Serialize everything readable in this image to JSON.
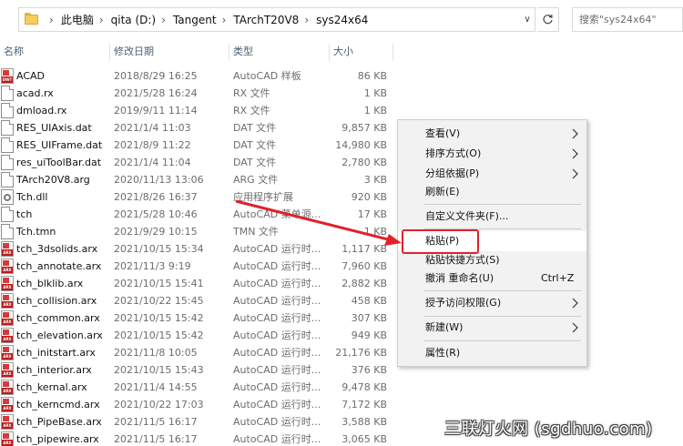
{
  "address_bar": {
    "crumbs": [
      "此电脑",
      "qita (D:)",
      "Tangent",
      "TArchT20V8",
      "sys24x64"
    ],
    "search_placeholder": "搜索\"sys24x64\""
  },
  "columns": {
    "name": "名称",
    "date": "修改日期",
    "type": "类型",
    "size": "大小"
  },
  "files": [
    {
      "name": "ACAD",
      "date": "2018/8/29 16:25",
      "type": "AutoCAD 样板",
      "size": "86 KB",
      "icon": "dwt-file-icon"
    },
    {
      "name": "acad.rx",
      "date": "2021/5/28 16:24",
      "type": "RX 文件",
      "size": "1 KB",
      "icon": "file-icon"
    },
    {
      "name": "dmload.rx",
      "date": "2019/9/11 11:14",
      "type": "RX 文件",
      "size": "1 KB",
      "icon": "file-icon"
    },
    {
      "name": "RES_UIAxis.dat",
      "date": "2021/1/4 11:03",
      "type": "DAT 文件",
      "size": "9,857 KB",
      "icon": "file-icon"
    },
    {
      "name": "RES_UIFrame.dat",
      "date": "2021/8/9 11:22",
      "type": "DAT 文件",
      "size": "14,980 KB",
      "icon": "file-icon"
    },
    {
      "name": "res_uiToolBar.dat",
      "date": "2021/1/4 11:04",
      "type": "DAT 文件",
      "size": "2,780 KB",
      "icon": "file-icon"
    },
    {
      "name": "TArch20V8.arg",
      "date": "2020/11/13 13:06",
      "type": "ARG 文件",
      "size": "3 KB",
      "icon": "file-icon"
    },
    {
      "name": "Tch.dll",
      "date": "2021/8/26 16:37",
      "type": "应用程序扩展",
      "size": "920 KB",
      "icon": "dll-gear-icon"
    },
    {
      "name": "tch",
      "date": "2021/5/28 10:46",
      "type": "AutoCAD 菜单源...",
      "size": "17 KB",
      "icon": "file-icon"
    },
    {
      "name": "Tch.tmn",
      "date": "2021/9/29 10:15",
      "type": "TMN 文件",
      "size": "1 KB",
      "icon": "file-icon"
    },
    {
      "name": "tch_3dsolids.arx",
      "date": "2021/10/15 15:34",
      "type": "AutoCAD 运行时...",
      "size": "1,117 KB",
      "icon": "arx-file-icon"
    },
    {
      "name": "tch_annotate.arx",
      "date": "2021/11/3 9:19",
      "type": "AutoCAD 运行时...",
      "size": "7,960 KB",
      "icon": "arx-file-icon"
    },
    {
      "name": "tch_blklib.arx",
      "date": "2021/10/15 15:41",
      "type": "AutoCAD 运行时...",
      "size": "2,882 KB",
      "icon": "arx-file-icon"
    },
    {
      "name": "tch_collision.arx",
      "date": "2021/10/22 15:45",
      "type": "AutoCAD 运行时...",
      "size": "458 KB",
      "icon": "arx-file-icon"
    },
    {
      "name": "tch_common.arx",
      "date": "2021/10/15 15:42",
      "type": "AutoCAD 运行时...",
      "size": "307 KB",
      "icon": "arx-file-icon"
    },
    {
      "name": "tch_elevation.arx",
      "date": "2021/10/15 15:42",
      "type": "AutoCAD 运行时...",
      "size": "949 KB",
      "icon": "arx-file-icon"
    },
    {
      "name": "tch_initstart.arx",
      "date": "2021/11/8 10:05",
      "type": "AutoCAD 运行时...",
      "size": "21,176 KB",
      "icon": "arx-file-icon"
    },
    {
      "name": "tch_interior.arx",
      "date": "2021/10/15 15:43",
      "type": "AutoCAD 运行时...",
      "size": "376 KB",
      "icon": "arx-file-icon"
    },
    {
      "name": "tch_kernal.arx",
      "date": "2021/11/4 14:55",
      "type": "AutoCAD 运行时...",
      "size": "9,478 KB",
      "icon": "arx-file-icon"
    },
    {
      "name": "tch_kerncmd.arx",
      "date": "2021/10/22 17:03",
      "type": "AutoCAD 运行时...",
      "size": "7,172 KB",
      "icon": "arx-file-icon"
    },
    {
      "name": "tch_PipeBase.arx",
      "date": "2021/11/5 16:17",
      "type": "AutoCAD 运行时...",
      "size": "3,588 KB",
      "icon": "arx-file-icon"
    },
    {
      "name": "tch_pipewire.arx",
      "date": "2021/11/5 16:17",
      "type": "AutoCAD 运行时...",
      "size": "3,065 KB",
      "icon": "arx-file-icon"
    }
  ],
  "context_menu": {
    "items": [
      {
        "label": "查看(V)",
        "submenu": true
      },
      {
        "label": "排序方式(O)",
        "submenu": true
      },
      {
        "label": "分组依据(P)",
        "submenu": true
      },
      {
        "label": "刷新(E)",
        "submenu": false
      },
      {
        "label": "自定义文件夹(F)...",
        "submenu": false
      },
      {
        "label": "粘贴(P)",
        "submenu": false,
        "highlighted": true
      },
      {
        "label": "粘贴快捷方式(S)",
        "submenu": false
      },
      {
        "label": "撤消 重命名(U)",
        "submenu": false,
        "shortcut": "Ctrl+Z"
      },
      {
        "label": "授予访问权限(G)",
        "submenu": true
      },
      {
        "label": "新建(W)",
        "submenu": true
      },
      {
        "label": "属性(R)",
        "submenu": false
      }
    ]
  },
  "watermark": "三联灯火网 (sgdhuo.com)",
  "colors": {
    "annotation_red": "#e0222c",
    "arx_red": "#b81c1c",
    "header_text": "#4c607a"
  }
}
